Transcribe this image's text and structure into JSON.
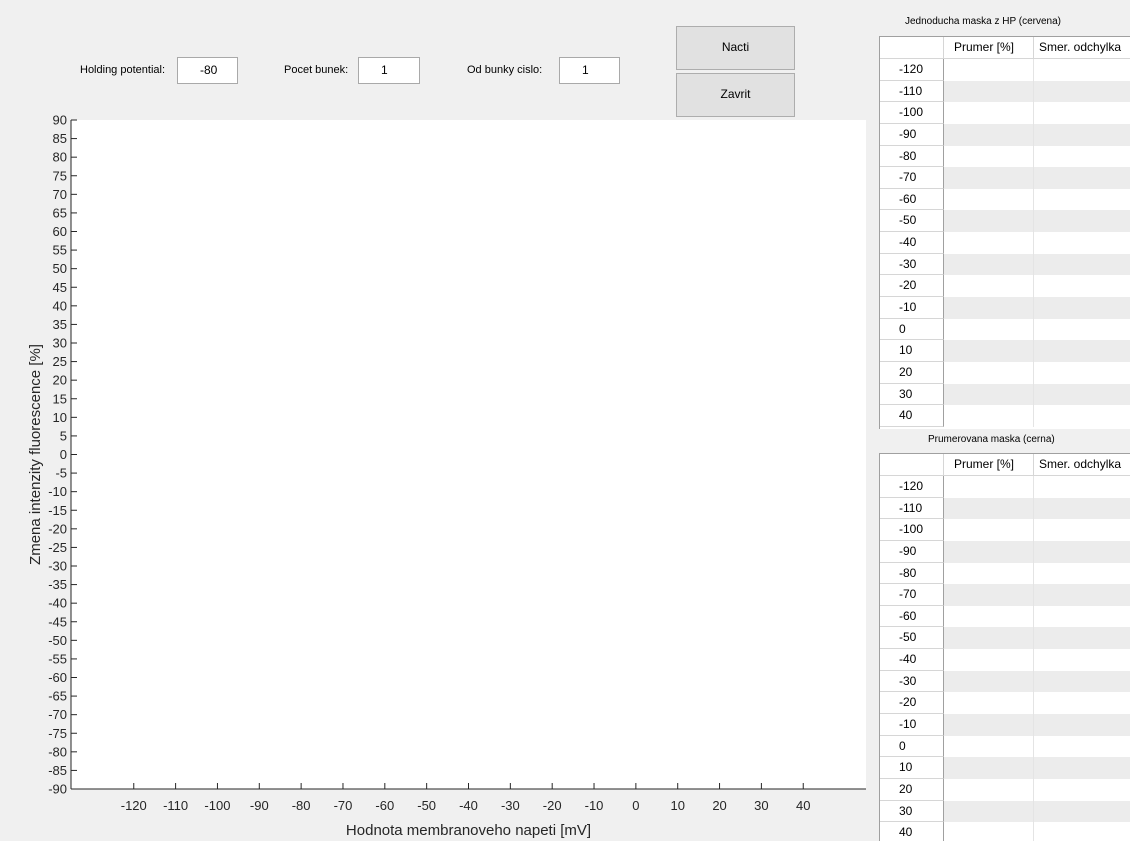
{
  "controls": {
    "holding_potential": {
      "label": "Holding potential:",
      "value": "-80"
    },
    "pocet_bunek": {
      "label": "Pocet bunek:",
      "value": "1"
    },
    "od_bunky_cislo": {
      "label": "Od bunky cislo:",
      "value": "1"
    },
    "nacti_label": "Nacti",
    "zavrit_label": "Zavrit"
  },
  "chart_data": {
    "type": "line",
    "xlabel": "Hodnota membranoveho napeti [mV]",
    "ylabel": "Zmena intenzity fluorescence [%]",
    "x_ticks": [
      -120,
      -110,
      -100,
      -90,
      -80,
      -70,
      -60,
      -50,
      -40,
      -30,
      -20,
      -10,
      0,
      10,
      20,
      30,
      40
    ],
    "y_ticks": [
      90,
      85,
      80,
      75,
      70,
      65,
      60,
      55,
      50,
      45,
      40,
      35,
      30,
      25,
      20,
      15,
      10,
      5,
      0,
      -5,
      -10,
      -15,
      -20,
      -25,
      -30,
      -35,
      -40,
      -45,
      -50,
      -55,
      -60,
      -65,
      -70,
      -75,
      -80,
      -85,
      -90
    ],
    "xlim": [
      -135,
      55
    ],
    "ylim": [
      -90,
      90
    ],
    "series": []
  },
  "table_red": {
    "title": "Jednoducha maska z HP (cervena)",
    "columns": [
      "Prumer [%]",
      "Smer. odchylka"
    ],
    "rows": [
      "-120",
      "-110",
      "-100",
      "-90",
      "-80",
      "-70",
      "-60",
      "-50",
      "-40",
      "-30",
      "-20",
      "-10",
      "0",
      "10",
      "20",
      "30",
      "40"
    ]
  },
  "table_black": {
    "title": "Prumerovana maska (cerna)",
    "columns": [
      "Prumer [%]",
      "Smer. odchylka"
    ],
    "rows": [
      "-120",
      "-110",
      "-100",
      "-90",
      "-80",
      "-70",
      "-60",
      "-50",
      "-40",
      "-30",
      "-20",
      "-10",
      "0",
      "10",
      "20",
      "30",
      "40"
    ]
  }
}
